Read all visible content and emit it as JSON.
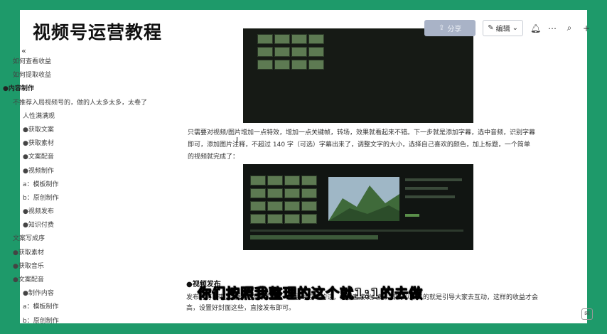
{
  "watermark": "视频号运营教程",
  "toolbar": {
    "share_label": "分享",
    "edit_label": "编辑",
    "bell_icon": "bell-icon",
    "more_icon": "more-icon",
    "search_icon": "search-icon",
    "add_icon": "plus-icon"
  },
  "sidebar": {
    "collapse_icon": "«",
    "items": [
      {
        "label": "如何查看收益",
        "indent": 1,
        "bold": false
      },
      {
        "label": "如何提取收益",
        "indent": 1,
        "bold": false
      },
      {
        "label": "●内容制作",
        "indent": 0,
        "bold": true
      },
      {
        "label": "不推荐入局视频号的，做的人太多太多，太卷了",
        "indent": 1,
        "bold": false
      },
      {
        "label": "人性满满观",
        "indent": 2,
        "bold": false
      },
      {
        "label": "●获取文案",
        "indent": 2,
        "bold": false
      },
      {
        "label": "●获取素材",
        "indent": 2,
        "bold": false
      },
      {
        "label": "●文案配音",
        "indent": 2,
        "bold": false
      },
      {
        "label": "●视频制作",
        "indent": 2,
        "bold": false
      },
      {
        "label": "a：模板制作",
        "indent": 2,
        "bold": false
      },
      {
        "label": "b：原创制作",
        "indent": 2,
        "bold": false
      },
      {
        "label": "●视频发布",
        "indent": 2,
        "bold": false
      },
      {
        "label": "●知识付费",
        "indent": 2,
        "bold": false
      },
      {
        "label": "文案写成序",
        "indent": 1,
        "bold": false
      },
      {
        "label": "●获取素材",
        "indent": 1,
        "bold": false
      },
      {
        "label": "●获取音乐",
        "indent": 1,
        "bold": false
      },
      {
        "label": "●文案配音",
        "indent": 1,
        "bold": false
      },
      {
        "label": "●制作内容",
        "indent": 2,
        "bold": false
      },
      {
        "label": "a：模板制作",
        "indent": 2,
        "bold": false
      },
      {
        "label": "b：原创制作",
        "indent": 2,
        "bold": false
      }
    ]
  },
  "content": {
    "paragraph": "只需要对视频/图片增加一点特效，增加一点关键帧，转场，效果就看起来不错。下一步就是添加字幕，选中音频，识别字幕即可，添加图片注释，不超过 140 字（可选）字幕出来了，调整文字的大小，选择自己喜欢的颜色，加上标题，一个简单的视频就完成了：",
    "section_title": "●视频发布",
    "section_text": "发布时可以带上话题，文案可以写一些引导互动的话，或者直接发文案，都可以。目的就是引导大家去互动，这样的收益才会高，设置好封面这些，直接发布即可。"
  },
  "subtitle_caption": "你们按照我整理的这个就1:1的去做",
  "colors": {
    "frame": "#1e9a6a",
    "accent_button": "#a9b3c7"
  }
}
